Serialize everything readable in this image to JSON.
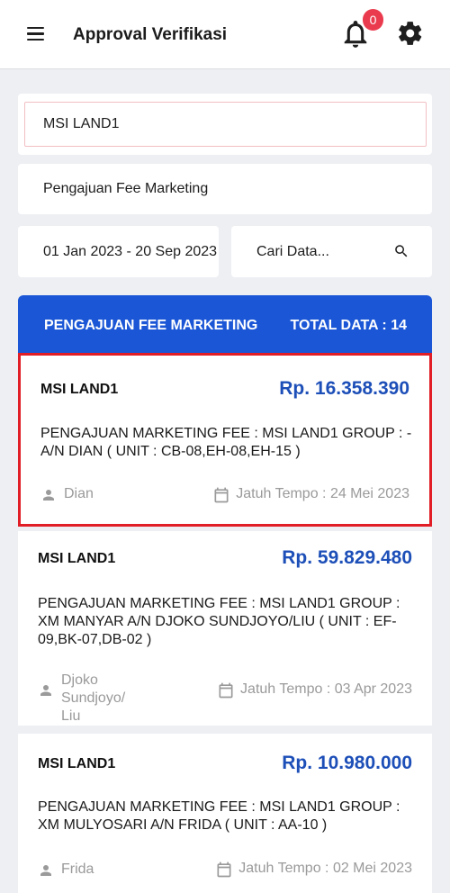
{
  "appbar": {
    "title": "Approval Verifikasi",
    "notification_count": "0"
  },
  "filters": {
    "company": "MSI LAND1",
    "type": "Pengajuan Fee Marketing",
    "date_range": "01 Jan 2023 - 20 Sep 2023",
    "search_placeholder": "Cari Data..."
  },
  "list": {
    "header_title": "PENGAJUAN FEE MARKETING",
    "total_label": "TOTAL DATA : 14",
    "items": [
      {
        "company": "MSI LAND1",
        "amount": "Rp. 16.358.390",
        "description": "PENGAJUAN MARKETING FEE : MSI LAND1 GROUP : - A/N DIAN ( UNIT : CB-08,EH-08,EH-15 )",
        "person": "Dian",
        "due": "Jatuh Tempo :  24 Mei 2023"
      },
      {
        "company": "MSI LAND1",
        "amount": "Rp. 59.829.480",
        "description": "PENGAJUAN MARKETING FEE : MSI LAND1 GROUP : XM MANYAR A/N DJOKO SUNDJOYO/LIU ( UNIT : EF-09,BK-07,DB-02 )",
        "person": "Djoko Sundjoyo/\nLiu",
        "due": "Jatuh Tempo :  03 Apr 2023"
      },
      {
        "company": "MSI LAND1",
        "amount": "Rp. 10.980.000",
        "description": "PENGAJUAN MARKETING FEE : MSI LAND1 GROUP : XM MULYOSARI A/N FRIDA ( UNIT : AA-10 )",
        "person": "Frida",
        "due": "Jatuh Tempo :  02 Mei 2023"
      }
    ]
  },
  "colors": {
    "primary": "#1a56d6",
    "amount": "#1d4fb8",
    "badge": "#ea3b4e",
    "selected_border": "#e11d26"
  },
  "icons": [
    "hamburger-menu-icon",
    "bell-icon",
    "gear-icon",
    "search-icon",
    "person-icon",
    "calendar-icon"
  ]
}
